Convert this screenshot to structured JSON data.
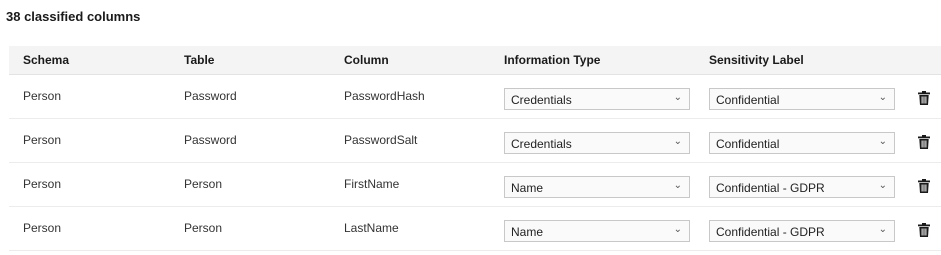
{
  "title": "38 classified columns",
  "headers": {
    "schema": "Schema",
    "table": "Table",
    "column": "Column",
    "information_type": "Information Type",
    "sensitivity_label": "Sensitivity Label"
  },
  "rows": [
    {
      "schema": "Person",
      "table": "Password",
      "column": "PasswordHash",
      "information_type": "Credentials",
      "sensitivity_label": "Confidential"
    },
    {
      "schema": "Person",
      "table": "Password",
      "column": "PasswordSalt",
      "information_type": "Credentials",
      "sensitivity_label": "Confidential"
    },
    {
      "schema": "Person",
      "table": "Person",
      "column": "FirstName",
      "information_type": "Name",
      "sensitivity_label": "Confidential - GDPR"
    },
    {
      "schema": "Person",
      "table": "Person",
      "column": "LastName",
      "information_type": "Name",
      "sensitivity_label": "Confidential - GDPR"
    }
  ],
  "icons": {
    "dropdown": "chevron-down-icon",
    "delete": "trash-icon"
  }
}
